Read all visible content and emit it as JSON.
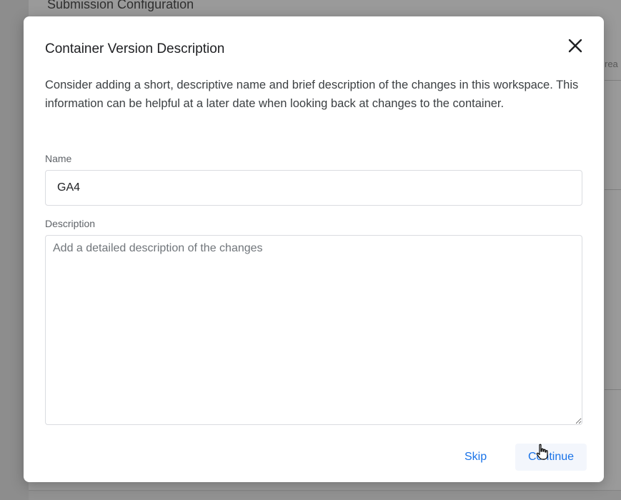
{
  "background": {
    "section_title": "Submission Configuration",
    "right_partial_text": "rea"
  },
  "dialog": {
    "title": "Container Version Description",
    "description": "Consider adding a short, descriptive name and brief description of the changes in this workspace. This information can be helpful at a later date when looking back at changes to the container.",
    "name_label": "Name",
    "name_value": "GA4",
    "description_label": "Description",
    "description_placeholder": "Add a detailed description of the changes",
    "description_value": "",
    "skip_label": "Skip",
    "continue_label": "Continue",
    "close_icon": "close-icon"
  },
  "colors": {
    "accent": "#1a73e8",
    "overlay": "#8d8d8d",
    "continue_bg": "#f3f6fc"
  }
}
